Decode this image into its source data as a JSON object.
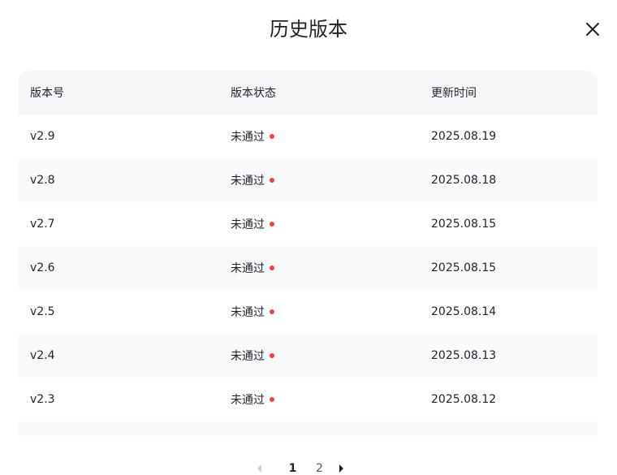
{
  "dialog": {
    "title": "历史版本"
  },
  "table": {
    "headers": {
      "version": "版本号",
      "status": "版本状态",
      "updated": "更新时间"
    },
    "rows": [
      {
        "version": "v2.9",
        "status": "未通过",
        "updated": "2025.08.19"
      },
      {
        "version": "v2.8",
        "status": "未通过",
        "updated": "2025.08.18"
      },
      {
        "version": "v2.7",
        "status": "未通过",
        "updated": "2025.08.15"
      },
      {
        "version": "v2.6",
        "status": "未通过",
        "updated": "2025.08.15"
      },
      {
        "version": "v2.5",
        "status": "未通过",
        "updated": "2025.08.14"
      },
      {
        "version": "v2.4",
        "status": "未通过",
        "updated": "2025.08.13"
      },
      {
        "version": "v2.3",
        "status": "未通过",
        "updated": "2025.08.12"
      }
    ]
  },
  "pagination": {
    "pages": [
      "1",
      "2"
    ],
    "current": "1"
  },
  "colors": {
    "status_failed": "#f53f3f",
    "header_bg": "#f6f7f9"
  }
}
